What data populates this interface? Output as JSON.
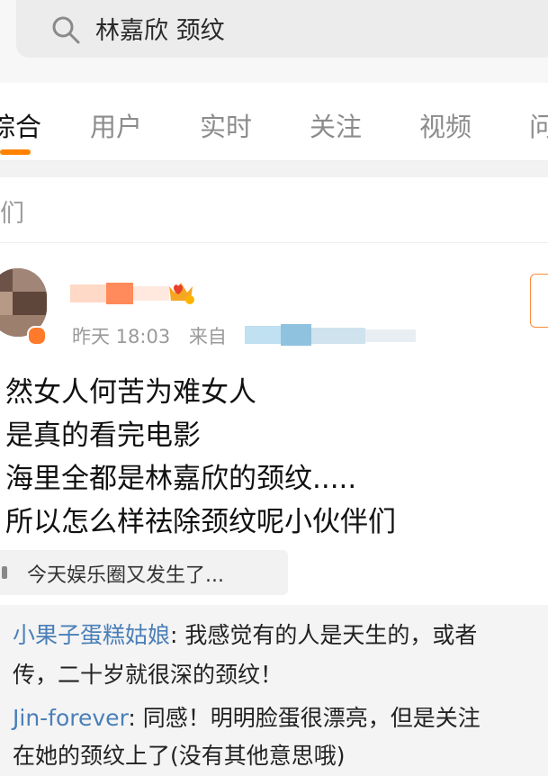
{
  "search": {
    "query": "林嘉欣 颈纹"
  },
  "tabs": [
    {
      "label": "综合",
      "active": true
    },
    {
      "label": "用户",
      "active": false
    },
    {
      "label": "实时",
      "active": false
    },
    {
      "label": "关注",
      "active": false
    },
    {
      "label": "视频",
      "active": false
    },
    {
      "label": "问",
      "active": false
    }
  ],
  "filter": {
    "label": "们"
  },
  "post": {
    "meta_time": "昨天 18:03",
    "meta_source_prefix": "来自",
    "lines": [
      "然女人何苦为难女人",
      "是真的看完电影",
      "海里全都是林嘉欣的颈纹.....",
      "所以怎么样祛除颈纹呢小伙伴们"
    ],
    "topic": "今天娱乐圈又发生了..."
  },
  "comments": [
    {
      "user": "小果子蛋糕姑娘",
      "text": ": 我感觉有的人是天生的，或者"
    },
    {
      "user": "",
      "text": "传，二十岁就很深的颈纹！"
    },
    {
      "user": "Jin-forever",
      "text": ": 同感！明明脸蛋很漂亮，但是关注"
    },
    {
      "user": "",
      "text": "在她的颈纹上了(没有其他意思哦)"
    }
  ],
  "colors": {
    "accent": "#ff8200",
    "link": "#4a7fb8",
    "muted": "#9a9a9a"
  },
  "icons": {
    "search": "search-icon",
    "vip": "vip-crown-icon",
    "topic": "topic-icon"
  }
}
